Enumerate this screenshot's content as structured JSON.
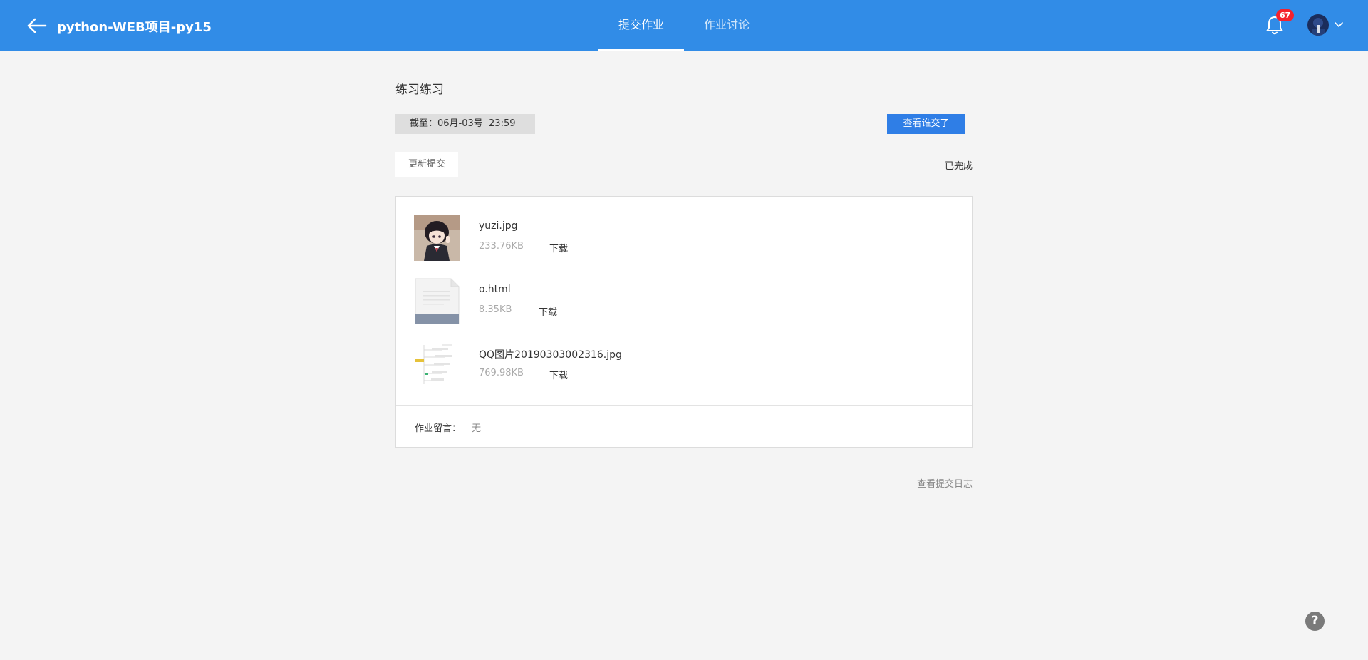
{
  "header": {
    "course_title": "python-WEB项目-py15",
    "tabs": [
      {
        "label": "提交作业",
        "active": true
      },
      {
        "label": "作业讨论",
        "active": false
      }
    ],
    "notification_count": "67",
    "accent_color": "#318ce7"
  },
  "assignment": {
    "title": "练习练习",
    "deadline": "截至：06月-03号  23:59",
    "view_submitted_label": "查看谁交了",
    "update_submit_label": "更新提交",
    "status": "已完成"
  },
  "files": [
    {
      "name": "yuzi.jpg",
      "size": "233.76KB",
      "download_label": "下载",
      "icon": "image-thumbnail-icon"
    },
    {
      "name": "o.html",
      "size": "8.35KB",
      "download_label": "下载",
      "icon": "document-file-icon"
    },
    {
      "name": "QQ图片20190303002316.jpg",
      "size": "769.98KB",
      "download_label": "下载",
      "icon": "mindmap-thumbnail-icon"
    }
  ],
  "remark": {
    "label": "作业留言：",
    "value": "无"
  },
  "footer": {
    "log_link": "查看提交日志",
    "help_label": "?"
  }
}
